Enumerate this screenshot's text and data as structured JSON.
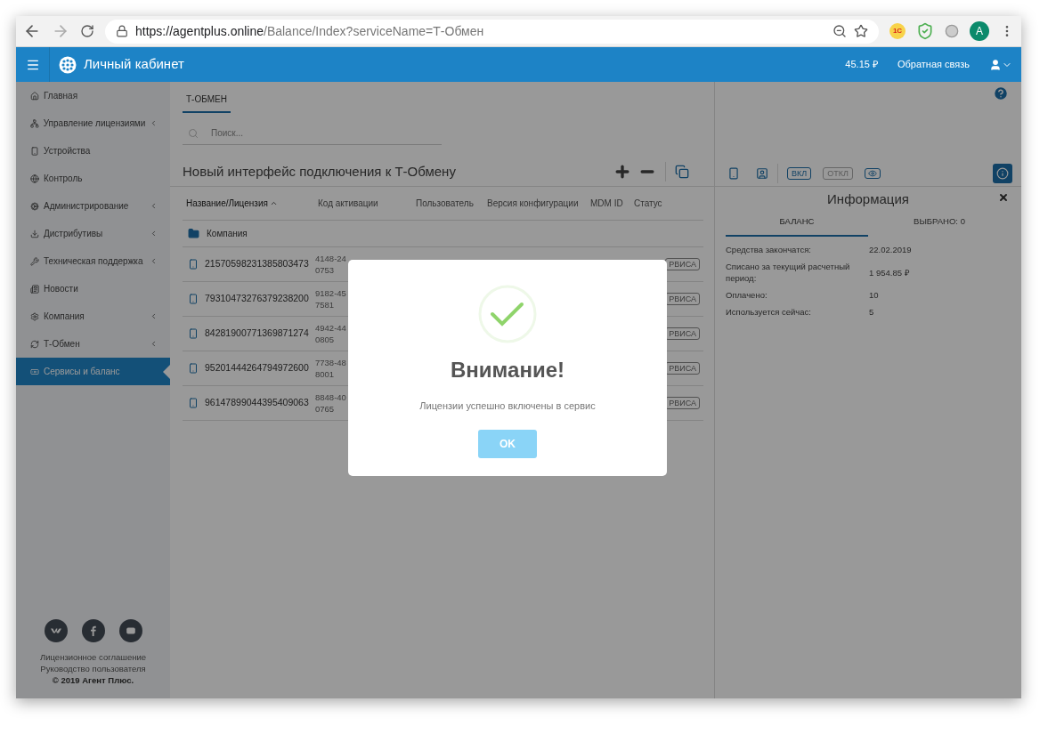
{
  "browser": {
    "url_origin": "https://agentplus.online",
    "url_path": "/Balance/Index?serviceName=Т-Обмен",
    "extension_label": "1С",
    "avatar": "A"
  },
  "header": {
    "title": "Личный кабинет",
    "balance": "45.15 ₽",
    "feedback": "Обратная связь"
  },
  "sidebar": {
    "items": [
      {
        "label": "Главная",
        "submenu": false,
        "selected": false
      },
      {
        "label": "Управление лицензиями",
        "submenu": true,
        "selected": false
      },
      {
        "label": "Устройства",
        "submenu": false,
        "selected": false
      },
      {
        "label": "Контроль",
        "submenu": false,
        "selected": false
      },
      {
        "label": "Администрирование",
        "submenu": true,
        "selected": false
      },
      {
        "label": "Дистрибутивы",
        "submenu": true,
        "selected": false
      },
      {
        "label": "Техническая поддержка",
        "submenu": true,
        "selected": false
      },
      {
        "label": "Новости",
        "submenu": false,
        "selected": false
      },
      {
        "label": "Компания",
        "submenu": true,
        "selected": false
      },
      {
        "label": "Т-Обмен",
        "submenu": true,
        "selected": false
      },
      {
        "label": "Сервисы и баланс",
        "submenu": false,
        "selected": true
      }
    ],
    "footer_links": [
      "Лицензионное соглашение",
      "Руководство пользователя"
    ],
    "copyright": "© 2019 Агент Плюс."
  },
  "main": {
    "tabs": [
      {
        "label": "Т-ОБМЕН",
        "selected": true
      }
    ],
    "search": {
      "placeholder": "Поиск..."
    },
    "title": "Новый интерфейс подключения к Т-Обмену",
    "table": {
      "columns": [
        {
          "label": "Название/Лицензия",
          "sorted": true
        },
        {
          "label": "Код активации",
          "sorted": false
        },
        {
          "label": "Пользователь",
          "sorted": false
        },
        {
          "label": "Версия конфигурации",
          "sorted": false
        },
        {
          "label": "MDM ID",
          "sorted": false
        },
        {
          "label": "Статус",
          "sorted": false
        }
      ],
      "group": "Компания",
      "rows": [
        {
          "license": "21570598231385803473",
          "code": [
            "4148-24",
            "0753"
          ],
          "status": "РВИСА"
        },
        {
          "license": "79310473276379238200",
          "code": [
            "9182-45",
            "7581"
          ],
          "status": "РВИСА"
        },
        {
          "license": "84281900771369871274",
          "code": [
            "4942-44",
            "0805"
          ],
          "status": "РВИСА"
        },
        {
          "license": "95201444264794972600",
          "code": [
            "7738-48",
            "8001"
          ],
          "status": "РВИСА"
        },
        {
          "license": "96147899044395409063",
          "code": [
            "8848-40",
            "0765"
          ],
          "status": "РВИСА"
        }
      ]
    }
  },
  "info_panel": {
    "toggles": [
      {
        "label": "ВКЛ",
        "disabled": false
      },
      {
        "label": "ОТКЛ",
        "disabled": true
      }
    ],
    "title": "Информация",
    "tabs": [
      {
        "label": "БАЛАНС",
        "selected": true
      },
      {
        "label": "ВЫБРАНО: 0",
        "selected": false
      }
    ],
    "rows": [
      {
        "label": "Средства закончатся:",
        "value": "22.02.2019"
      },
      {
        "label": "Списано за текущий расчетный период:",
        "value": "1 954.85 ₽"
      },
      {
        "label": "Оплачено:",
        "value": "10"
      },
      {
        "label": "Используется сейчас:",
        "value": "5"
      }
    ]
  },
  "dialog": {
    "title": "Внимание!",
    "message": "Лицензии успешно включены в сервис",
    "button": "OK"
  }
}
